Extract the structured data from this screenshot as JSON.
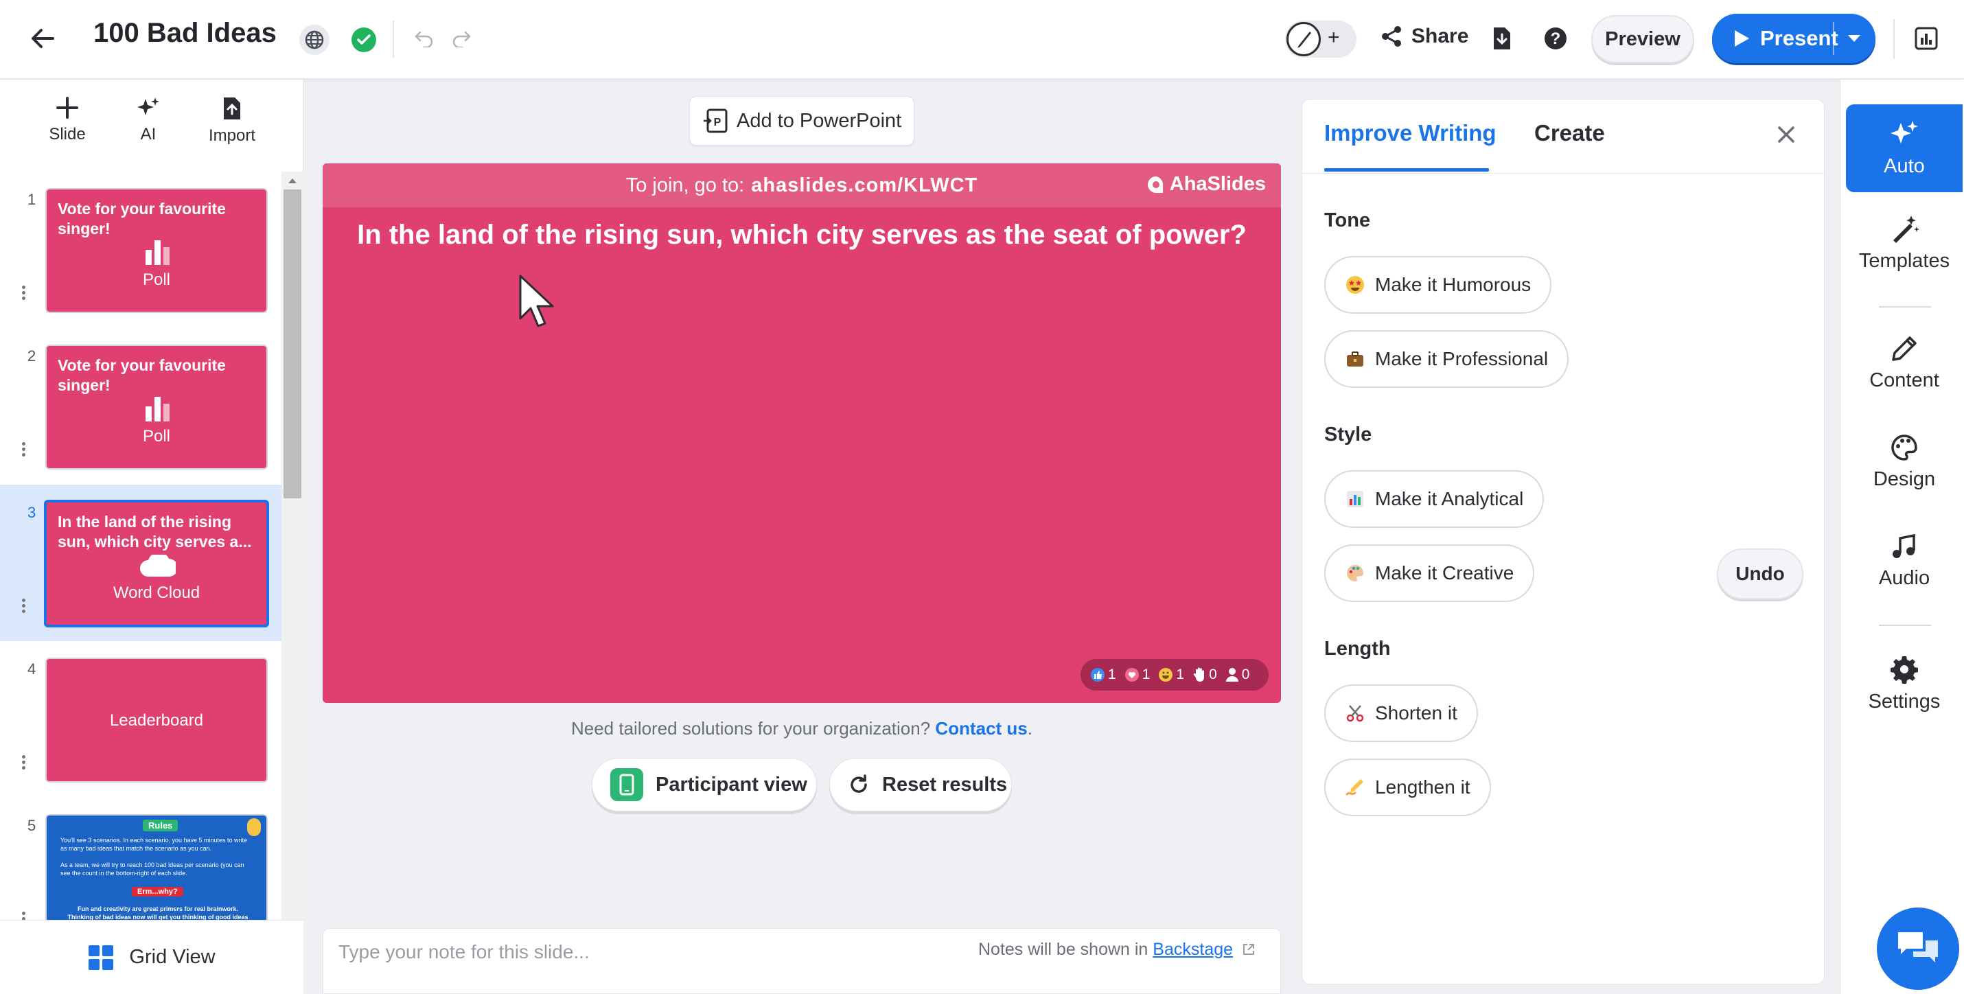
{
  "header": {
    "title": "100 Bad Ideas",
    "share_label": "Share",
    "preview_label": "Preview",
    "present_label": "Present"
  },
  "toolbar": {
    "slide_label": "Slide",
    "ai_label": "AI",
    "import_label": "Import"
  },
  "slides": [
    {
      "number": "1",
      "title": "Vote for your favourite singer!",
      "type": "Poll"
    },
    {
      "number": "2",
      "title": "Vote for your favourite singer!",
      "type": "Poll"
    },
    {
      "number": "3",
      "title": "In the land of the rising sun, which city serves a...",
      "type": "Word Cloud"
    },
    {
      "number": "4",
      "title": "",
      "type": "Leaderboard"
    },
    {
      "number": "5",
      "title": "Rules",
      "type": ""
    }
  ],
  "slide5_preview": {
    "heading": "Rules",
    "bullet1": "You'll see 3 scenarios. In each scenario, you have 5 minutes to write as many bad ideas that match the scenario as you can.",
    "bullet2": "As a team, we will try to reach 100 bad ideas per scenario (you can see the count in the bottom-right of each slide.",
    "why": "Erm...why?",
    "footer": "Fun and creativity are great primers for real brainwork. Thinking of bad ideas now will get you thinking of good ideas later!"
  },
  "grid_view_label": "Grid View",
  "center": {
    "add_to_ppt_label": "Add to PowerPoint",
    "join_prefix": "To join, go to:",
    "join_url": "ahaslides.com/KLWCT",
    "brand": "AhaSlides",
    "question": "In the land of the rising sun, which city serves as the seat of power?",
    "reactions": {
      "like": "1",
      "heart": "1",
      "laugh": "1",
      "hand": "0",
      "people": "0"
    },
    "tailored_text": "Need tailored solutions for your organization?",
    "contact_link": "Contact us",
    "participant_view_label": "Participant view",
    "reset_results_label": "Reset results",
    "notes_placeholder": "Type your note for this slide...",
    "notes_info": "Notes will be shown in",
    "notes_link": "Backstage"
  },
  "ai_panel": {
    "tab_improve": "Improve Writing",
    "tab_create": "Create",
    "tone_label": "Tone",
    "style_label": "Style",
    "length_label": "Length",
    "humorous": "Make it Humorous",
    "professional": "Make it Professional",
    "analytical": "Make it Analytical",
    "creative": "Make it Creative",
    "shorten": "Shorten it",
    "lengthen": "Lengthen it",
    "undo": "Undo"
  },
  "rail": {
    "auto": "Auto",
    "templates": "Templates",
    "content": "Content",
    "design": "Design",
    "audio": "Audio",
    "settings": "Settings"
  },
  "colors": {
    "accent": "#1a73e8",
    "slide_bg": "#df4071",
    "success": "#22b35e"
  }
}
